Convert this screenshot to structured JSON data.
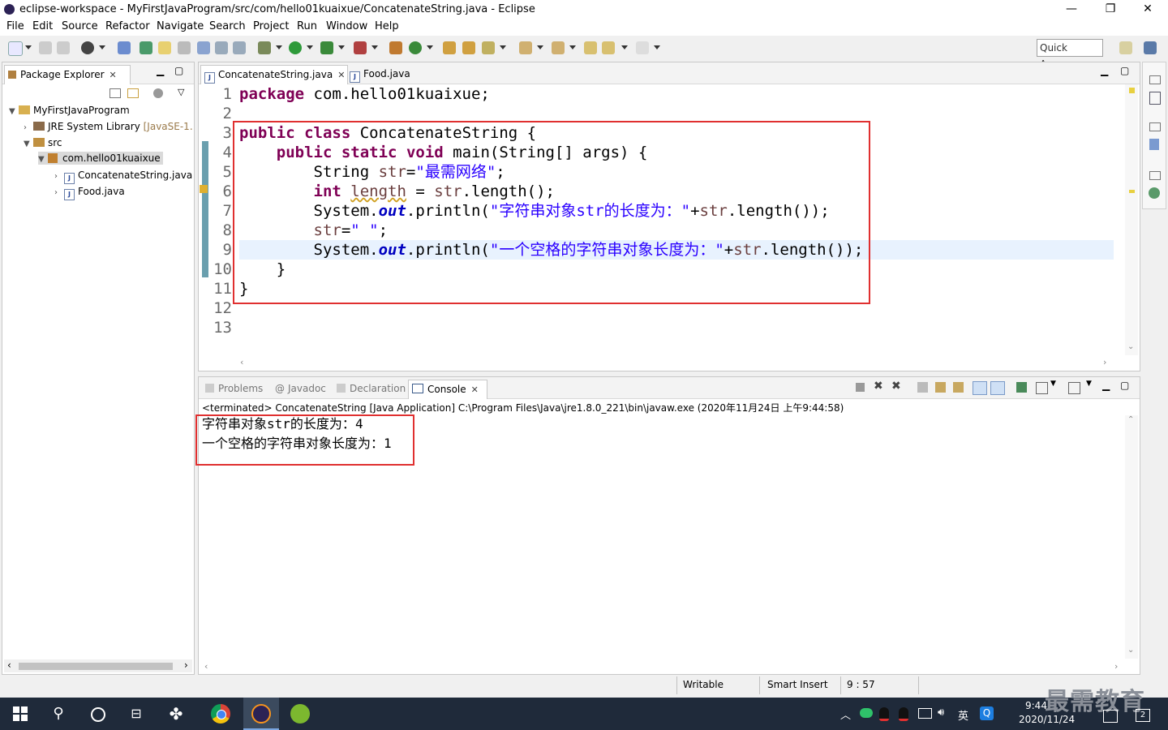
{
  "window": {
    "title": "eclipse-workspace - MyFirstJavaProgram/src/com/hello01kuaixue/ConcatenateString.java - Eclipse",
    "minimize": "—",
    "maximize": "❐",
    "close": "✕"
  },
  "menu": [
    "File",
    "Edit",
    "Source",
    "Refactor",
    "Navigate",
    "Search",
    "Project",
    "Run",
    "Window",
    "Help"
  ],
  "toolbar": {
    "quick_access": "Quick Access"
  },
  "package_explorer": {
    "tab_label": "Package Explorer",
    "tree": {
      "project": "MyFirstJavaProgram",
      "jre": "JRE System Library",
      "jre_suffix": "[JavaSE-1.",
      "src": "src",
      "package": "com.hello01kuaixue",
      "file1": "ConcatenateString.java",
      "file2": "Food.java"
    }
  },
  "editor": {
    "tabs": [
      "ConcatenateString.java",
      "Food.java"
    ],
    "line_numbers": [
      "1",
      "2",
      "3",
      "4",
      "5",
      "6",
      "7",
      "8",
      "9",
      "10",
      "11",
      "12",
      "13"
    ],
    "code": {
      "l1_kw": "package",
      "l1_rest": " com.hello01kuaixue;",
      "l3_kw1": "public",
      "l3_kw2": "class",
      "l3_rest": " ConcatenateString {",
      "l4_kw1": "public",
      "l4_kw2": "static",
      "l4_kw3": "void",
      "l4_rest": " main(String[] args) {",
      "l5_type": "String ",
      "l5_var": "str",
      "l5_eq": "=",
      "l5_str": "\"最需网络\"",
      "l5_end": ";",
      "l6_kw": "int",
      "l6_var": "length",
      "l6_mid": " = ",
      "l6_var2": "str",
      "l6_end": ".length();",
      "l7_a": "System.",
      "l7_out": "out",
      "l7_b": ".println(",
      "l7_str": "\"字符串对象str的长度为：\"",
      "l7_c": "+",
      "l7_var": "str",
      "l7_d": ".length());",
      "l8_var": "str",
      "l8_eq": "=",
      "l8_str": "\" \"",
      "l8_end": ";",
      "l9_a": "System.",
      "l9_out": "out",
      "l9_b": ".println(",
      "l9_str": "\"一个空格的字符串对象长度为：\"",
      "l9_c": "+",
      "l9_var": "str",
      "l9_d": ".length());",
      "l10": "}",
      "l11": "}"
    }
  },
  "console": {
    "tabs": [
      "Problems",
      "Javadoc",
      "Declaration",
      "Console"
    ],
    "header": "<terminated> ConcatenateString [Java Application] C:\\Program Files\\Java\\jre1.8.0_221\\bin\\javaw.exe (2020年11月24日 上午9:44:58)",
    "output_line1_a": "字符串对象",
    "output_line1_b": "str",
    "output_line1_c": "的长度为：",
    "output_line1_d": "4",
    "output_line2_a": "一个空格的字符串对象长度为：",
    "output_line2_b": "1"
  },
  "statusbar": {
    "writable": "Writable",
    "insert": "Smart Insert",
    "position": "9 : 57"
  },
  "taskbar": {
    "time": "9:44",
    "date": "2020/11/24",
    "ime": "英",
    "watermark": "最需教育",
    "notif_count": "2"
  },
  "colors": {
    "keyword": "#7f0055",
    "string": "#2a00ff",
    "field": "#0000c0",
    "highlight_box": "#e03030",
    "current_line": "#e8f2fe"
  }
}
